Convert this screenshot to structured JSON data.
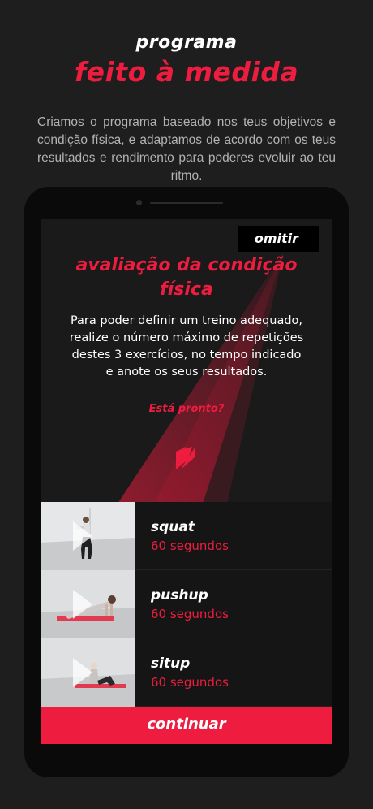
{
  "header": {
    "line1": "programa",
    "line2": "feito à medida",
    "intro": "Criamos o programa baseado nos teus objetivos e condição física, e adaptamos de acordo com os teus resultados e rendimento para poderes evoluir ao teu ritmo."
  },
  "screen": {
    "skip_label": "omitir",
    "title_line1": "avaliação da condição",
    "title_line2": "física",
    "description": "Para poder definir um treino adequado, realize o número máximo de repetições destes 3 exercícios, no tempo indicado e anote os seus resultados.",
    "ready": "Está pronto?",
    "logo_icon": "lightning-bolt-logo",
    "exercises": [
      {
        "name": "squat",
        "duration": "60 segundos"
      },
      {
        "name": "pushup",
        "duration": "60 segundos"
      },
      {
        "name": "situp",
        "duration": "60 segundos"
      }
    ],
    "continue_label": "continuar"
  },
  "colors": {
    "accent": "#ee1d3f",
    "background": "#1e1e1f",
    "phone": "#0a0a0a",
    "screen": "#1a1a1a"
  }
}
